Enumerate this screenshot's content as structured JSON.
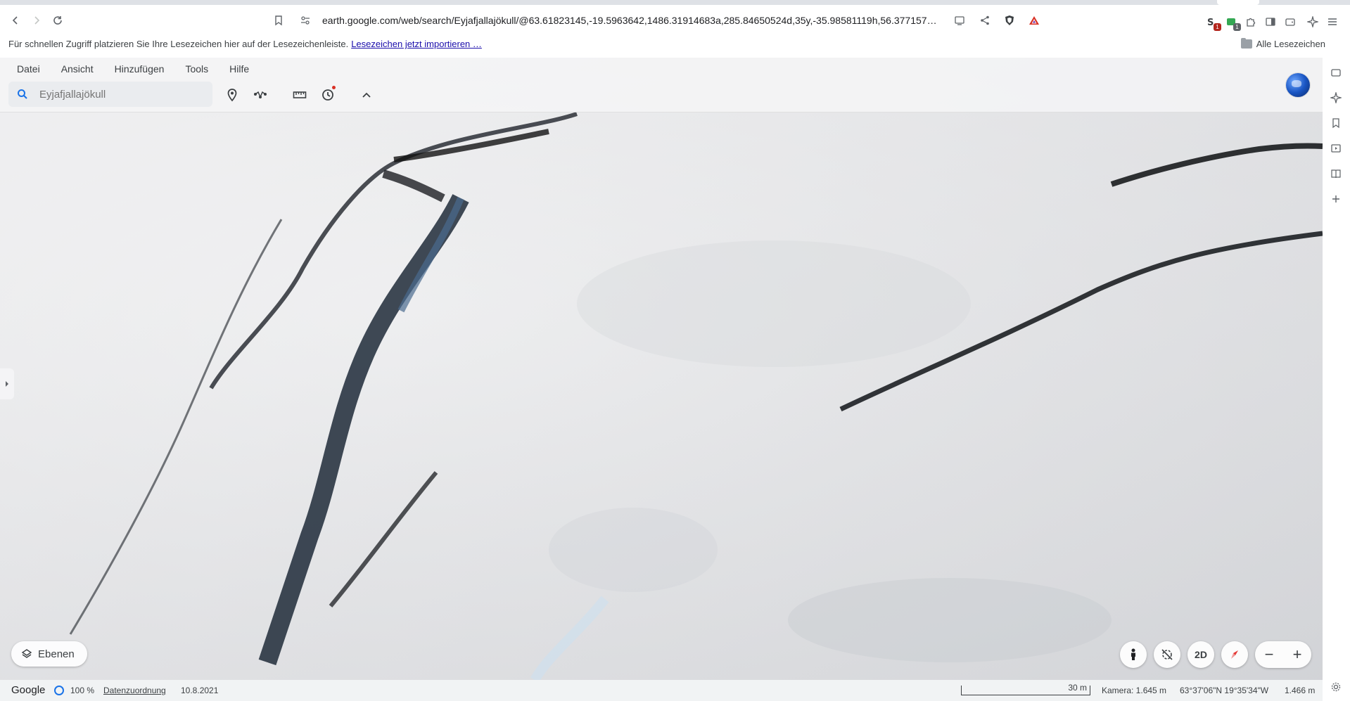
{
  "browser": {
    "url": "earth.google.com/web/search/Eyjafjallajökull/@63.61823145,-19.5963642,1486.31914683a,285.84650524d,35y,-35.98581119h,56.377157…",
    "extension_badges": [
      "1",
      "1"
    ],
    "bookmark_hint": "Für schnellen Zugriff platzieren Sie Ihre Lesezeichen hier auf der Lesezeichenleiste.",
    "bookmark_import_link": "Lesezeichen jetzt importieren …",
    "all_bookmarks": "Alle Lesezeichen"
  },
  "earth": {
    "menu": [
      "Datei",
      "Ansicht",
      "Hinzufügen",
      "Tools",
      "Hilfe"
    ],
    "search_placeholder": "Eyjafjallajökull",
    "layers_label": "Ebenen",
    "mode_2d": "2D",
    "status": {
      "logo": "Google",
      "loading": "100 %",
      "attribution": "Datenzuordnung",
      "date": "10.8.2021",
      "scale": "30 m",
      "camera": "Kamera: 1.645 m",
      "coords": "63°37'06\"N 19°35'34\"W",
      "altitude": "1.466 m"
    }
  },
  "icons": {
    "back": "back-arrow-icon",
    "forward": "forward-arrow-icon",
    "reload": "reload-icon",
    "bookmark": "bookmark-icon",
    "site_settings": "site-settings-icon",
    "cast": "cast-icon",
    "share": "share-icon",
    "brave": "brave-shield-icon",
    "rewards": "brave-rewards-icon",
    "search": "search-icon",
    "placemark": "placemark-icon",
    "path": "path-icon",
    "ruler": "ruler-icon",
    "history": "history-icon",
    "collapse": "chevron-up-icon",
    "globe": "globe-icon",
    "layers": "layers-icon",
    "pegman": "pegman-icon",
    "tilt": "tilt-icon",
    "compass": "compass-icon",
    "settings": "gear-icon"
  },
  "colors": {
    "accent": "#1a73e8",
    "link": "#1a0dab",
    "brave_orange": "#fb542b",
    "rewards_red": "#d93025",
    "compass_red": "#e53935"
  }
}
